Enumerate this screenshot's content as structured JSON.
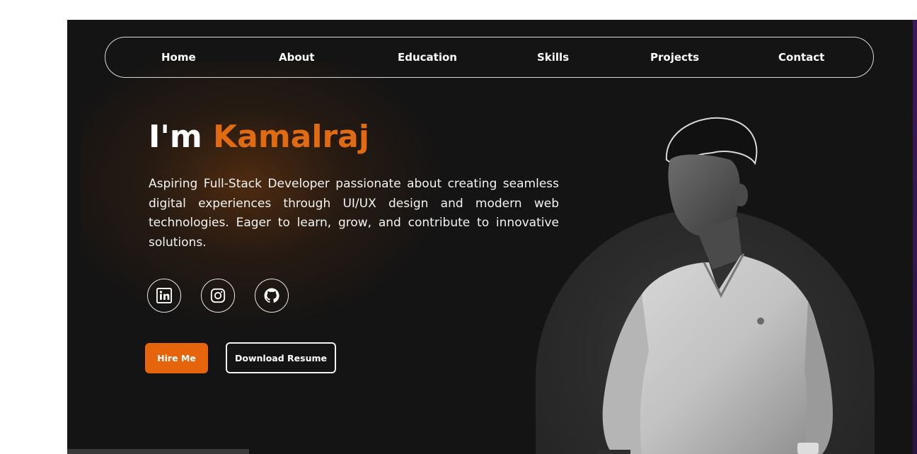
{
  "nav": {
    "items": [
      {
        "label": "Home"
      },
      {
        "label": "About"
      },
      {
        "label": "Education"
      },
      {
        "label": "Skills"
      },
      {
        "label": "Projects"
      },
      {
        "label": "Contact"
      }
    ]
  },
  "hero": {
    "greeting": "I'm",
    "name": "Kamalraj",
    "description": "Aspiring Full-Stack Developer passionate about creating seamless digital experiences through UI/UX design and modern web technologies. Eager to learn, grow, and contribute to innovative solutions."
  },
  "social": [
    {
      "icon": "linkedin-icon"
    },
    {
      "icon": "instagram-icon"
    },
    {
      "icon": "github-icon"
    }
  ],
  "buttons": {
    "hire": "Hire Me",
    "resume": "Download Resume"
  },
  "colors": {
    "accent": "#e06b12",
    "button": "#e6640c",
    "background": "#141414"
  }
}
